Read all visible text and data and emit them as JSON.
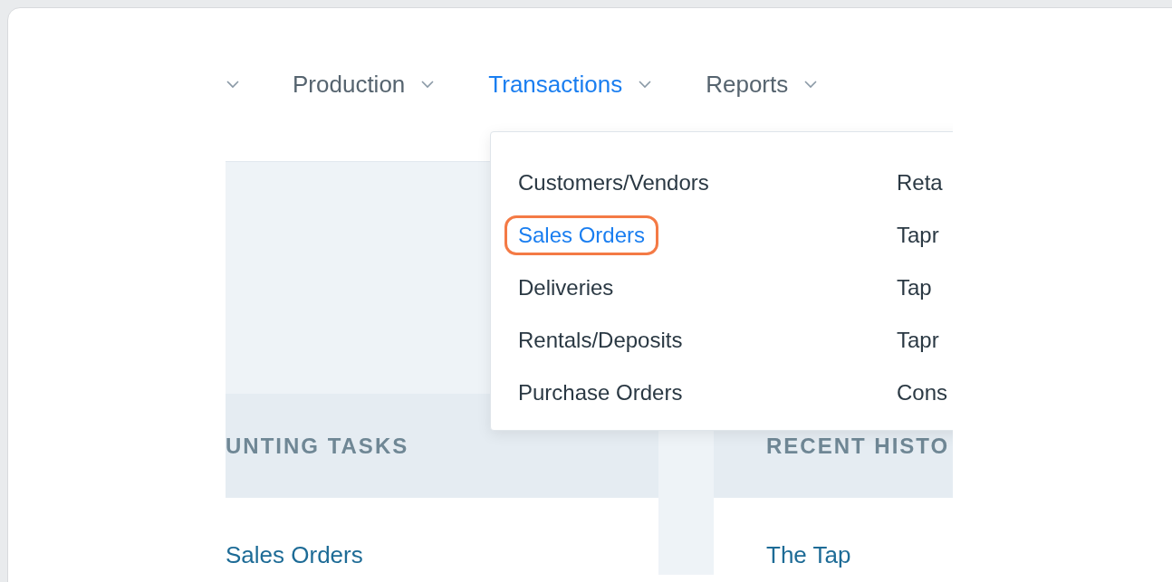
{
  "nav": {
    "items": [
      {
        "label": "Production",
        "selected": false
      },
      {
        "label": "Transactions",
        "selected": true
      },
      {
        "label": "Reports",
        "selected": false
      }
    ]
  },
  "dropdown": {
    "columns": [
      [
        {
          "label": "Customers/Vendors",
          "selected": false
        },
        {
          "label": "Sales Orders",
          "selected": true
        },
        {
          "label": "Deliveries",
          "selected": false
        },
        {
          "label": "Rentals/Deposits",
          "selected": false
        },
        {
          "label": "Purchase Orders",
          "selected": false
        }
      ],
      [
        {
          "label": "Reta",
          "selected": false
        },
        {
          "label": "Tapr",
          "selected": false
        },
        {
          "label": "Tap",
          "selected": false
        },
        {
          "label": "Tapr",
          "selected": false
        },
        {
          "label": "Cons",
          "selected": false
        }
      ]
    ]
  },
  "sections": [
    {
      "title": "UNTING TASKS",
      "link": "Sales Orders"
    },
    {
      "title": "RECENT HISTO",
      "link": "The Tap"
    }
  ]
}
